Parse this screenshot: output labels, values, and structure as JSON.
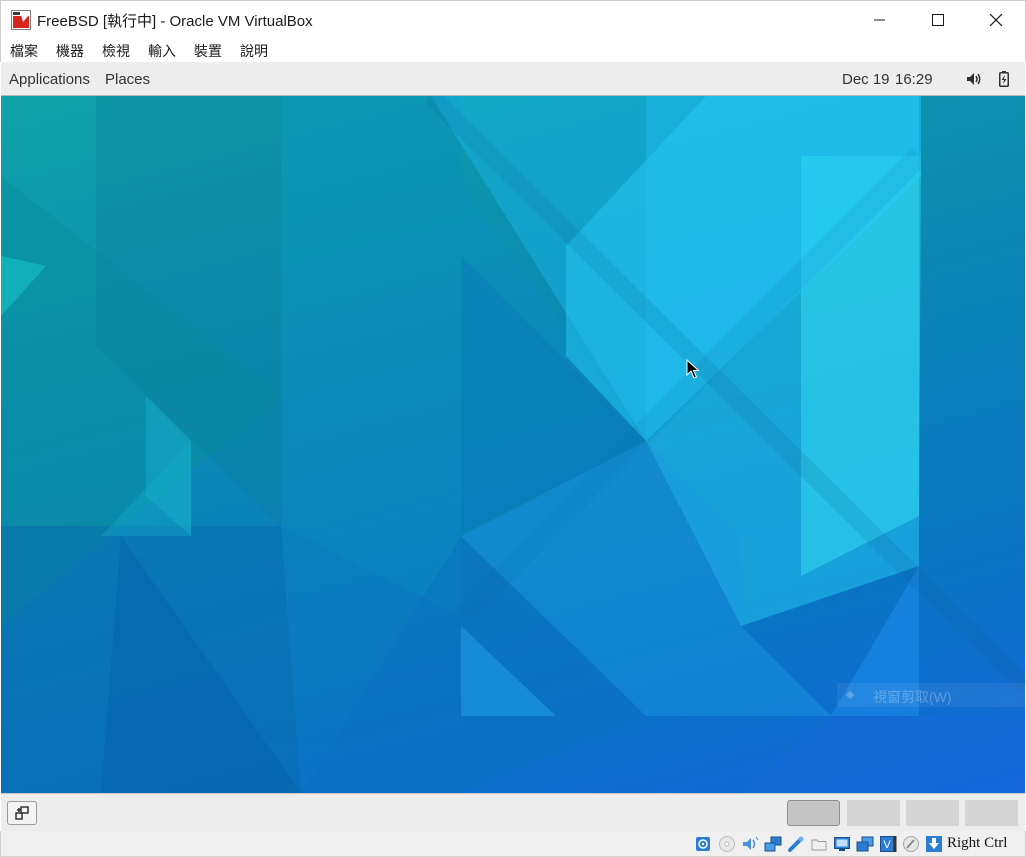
{
  "window": {
    "title": "FreeBSD [執行中] - Oracle VM VirtualBox",
    "app_icon": "virtualbox-vm-icon",
    "controls": [
      "minimize-icon",
      "maximize-icon",
      "close-icon"
    ]
  },
  "menubar": {
    "items": [
      {
        "label": "檔案"
      },
      {
        "label": "機器"
      },
      {
        "label": "檢視"
      },
      {
        "label": "輸入"
      },
      {
        "label": "裝置"
      },
      {
        "label": "說明"
      }
    ]
  },
  "gnome_panel": {
    "applications": "Applications",
    "places": "Places",
    "date": "Dec 19",
    "time": "16:29",
    "icons": [
      "volume-icon",
      "battery-icon"
    ]
  },
  "desktop": {
    "ghost_menu_label": "視窗剪取(W)"
  },
  "bottom_panel": {
    "show_desktop_icon": "show-desktop-icon",
    "workspaces": [
      {
        "name": "workspace-1",
        "active": true
      },
      {
        "name": "workspace-2",
        "active": false
      },
      {
        "name": "workspace-3",
        "active": false
      },
      {
        "name": "workspace-4",
        "active": false
      }
    ]
  },
  "statusbar": {
    "icons": [
      "hard-disk-icon",
      "optical-drive-icon",
      "audio-icon",
      "network-icon",
      "usb-icon",
      "shared-folders-icon",
      "display-icon",
      "video-capture-icon",
      "vt-x-icon",
      "mouse-integration-icon",
      "host-key-arrow-icon"
    ],
    "host_key": "Right Ctrl"
  },
  "colors": {
    "panel_bg": "#ededed",
    "desktop_top": "#0fa3a8",
    "desktop_bottom": "#1266d8"
  }
}
